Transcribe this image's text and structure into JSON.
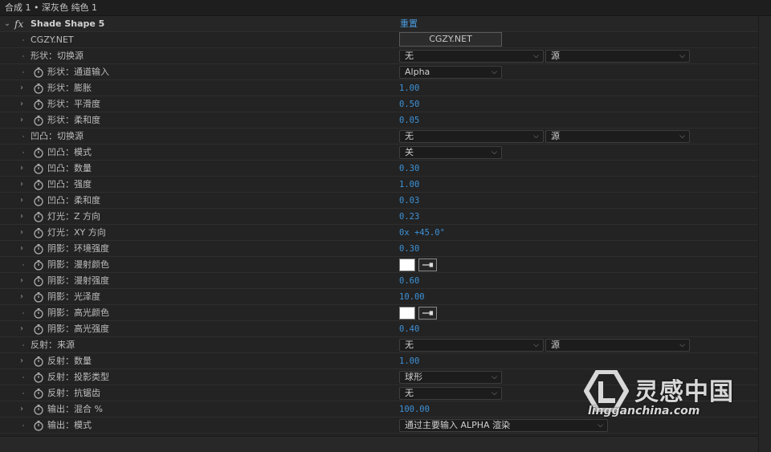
{
  "header": {
    "title": "合成 1 • 深灰色 纯色 1"
  },
  "effect": {
    "fx_label": "fx",
    "name": "Shade Shape 5",
    "reset_label": "重置"
  },
  "rows": [
    {
      "label": "CGZY.NET",
      "kind": "button",
      "value": "CGZY.NET"
    },
    {
      "label": "形状：切换源",
      "kind": "dual-dropdown",
      "value": "无",
      "value2": "源"
    },
    {
      "label": "形状：通道输入",
      "kind": "dropdown",
      "value": "Alpha"
    },
    {
      "label": "形状：膨胀",
      "kind": "number",
      "value": "1.00"
    },
    {
      "label": "形状：平滑度",
      "kind": "number",
      "value": "0.50"
    },
    {
      "label": "形状：柔和度",
      "kind": "number",
      "value": "0.05"
    },
    {
      "label": "凹凸：切换源",
      "kind": "dual-dropdown",
      "value": "无",
      "value2": "源"
    },
    {
      "label": "凹凸：模式",
      "kind": "dropdown",
      "value": "关"
    },
    {
      "label": "凹凸：数量",
      "kind": "number",
      "value": "0.30"
    },
    {
      "label": "凹凸：强度",
      "kind": "number",
      "value": "1.00"
    },
    {
      "label": "凹凸：柔和度",
      "kind": "number",
      "value": "0.03"
    },
    {
      "label": "灯光：Z 方向",
      "kind": "number",
      "value": "0.23"
    },
    {
      "label": "灯光：XY 方向",
      "kind": "number",
      "value": "0x +45.0°"
    },
    {
      "label": "阴影：环境强度",
      "kind": "number",
      "value": "0.30"
    },
    {
      "label": "阴影：漫射颜色",
      "kind": "color",
      "value": "#ffffff"
    },
    {
      "label": "阴影：漫射强度",
      "kind": "number",
      "value": "0.60"
    },
    {
      "label": "阴影：光泽度",
      "kind": "number",
      "value": "10.00"
    },
    {
      "label": "阴影：高光颜色",
      "kind": "color",
      "value": "#ffffff"
    },
    {
      "label": "阴影：高光强度",
      "kind": "number",
      "value": "0.40"
    },
    {
      "label": "反射：来源",
      "kind": "dual-dropdown",
      "value": "无",
      "value2": "源"
    },
    {
      "label": "反射：数量",
      "kind": "number",
      "value": "1.00"
    },
    {
      "label": "反射：投影类型",
      "kind": "dropdown",
      "value": "球形"
    },
    {
      "label": "反射：抗锯齿",
      "kind": "dropdown",
      "value": "无"
    },
    {
      "label": "输出：混合 %",
      "kind": "number",
      "value": "100.00"
    },
    {
      "label": "输出：模式",
      "kind": "dropdown",
      "value": "通过主要输入 ALPHA 渲染"
    }
  ],
  "watermark": {
    "brand": "灵感中国",
    "url": "lingganchina.com"
  },
  "colors": {
    "value_blue": "#3d91d6",
    "panel_bg": "#232323",
    "swatch": "#ffffff"
  }
}
